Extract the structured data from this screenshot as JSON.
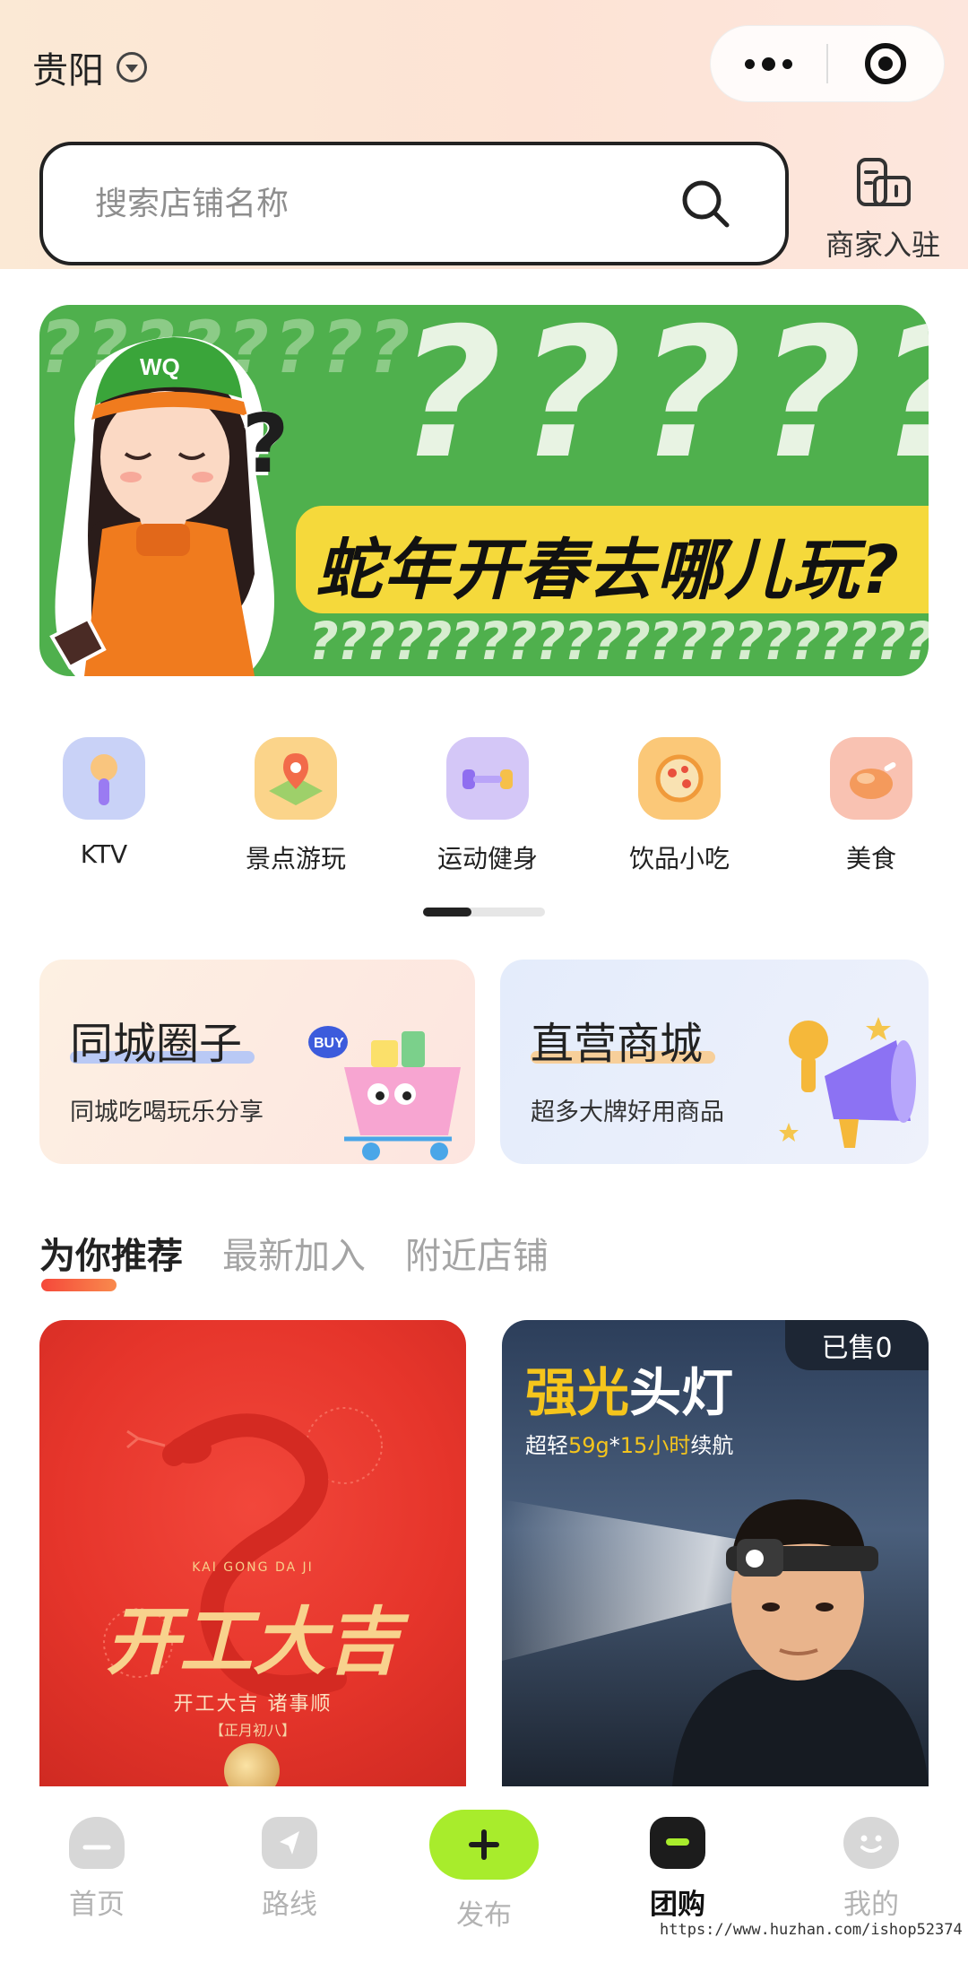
{
  "header": {
    "city": "贵阳",
    "search_placeholder": "搜索店铺名称",
    "merchant_label": "商家入驻"
  },
  "banner": {
    "top_marks": "??????",
    "faint_marks": "????????",
    "slogan": "蛇年开春去哪儿玩?",
    "bottom_marks": "???????????????????????",
    "cap_text": "WQ"
  },
  "categories": [
    {
      "label": "KTV",
      "icon": "microphone-icon",
      "bg": "#c9d2f7"
    },
    {
      "label": "景点游玩",
      "icon": "map-pin-icon",
      "bg": "#fbd48a"
    },
    {
      "label": "运动健身",
      "icon": "dumbbell-icon",
      "bg": "#d4c7f7"
    },
    {
      "label": "饮品小吃",
      "icon": "pizza-icon",
      "bg": "#fbc878"
    },
    {
      "label": "美食",
      "icon": "roast-chicken-icon",
      "bg": "#f9c2b2"
    }
  ],
  "promos": [
    {
      "title": "同城圈子",
      "subtitle": "同城吃喝玩乐分享",
      "badge": "BUY"
    },
    {
      "title": "直营商城",
      "subtitle": "超多大牌好用商品"
    }
  ],
  "tabs": [
    {
      "label": "为你推荐",
      "active": true
    },
    {
      "label": "最新加入",
      "active": false
    },
    {
      "label": "附近店铺",
      "active": false
    }
  ],
  "products": [
    {
      "small_text": "KAI GONG DA JI",
      "big_text": "开工大吉",
      "sub_text": "开工大吉 诸事顺",
      "date_text": "【正月初八】"
    },
    {
      "sold": "已售0",
      "title_highlight": "强光",
      "title_rest": "头灯",
      "sub_prefix": "超轻",
      "sub_weight": "59g",
      "sub_mid": "*",
      "sub_hours": "15小时",
      "sub_suffix": "续航"
    }
  ],
  "bottom_nav": [
    {
      "label": "首页",
      "icon": "home-icon",
      "active": false
    },
    {
      "label": "路线",
      "icon": "route-icon",
      "active": false
    },
    {
      "label": "发布",
      "icon": "plus-icon",
      "active": false
    },
    {
      "label": "团购",
      "icon": "group-buy-icon",
      "active": true
    },
    {
      "label": "我的",
      "icon": "profile-icon",
      "active": false
    }
  ],
  "watermark": "https://www.huzhan.com/ishop52374",
  "colors": {
    "brand_green": "#4fb04d",
    "accent_yellow": "#f5d93b",
    "publish_green": "#a8ec2c",
    "tab_underline": "#f5483a"
  }
}
